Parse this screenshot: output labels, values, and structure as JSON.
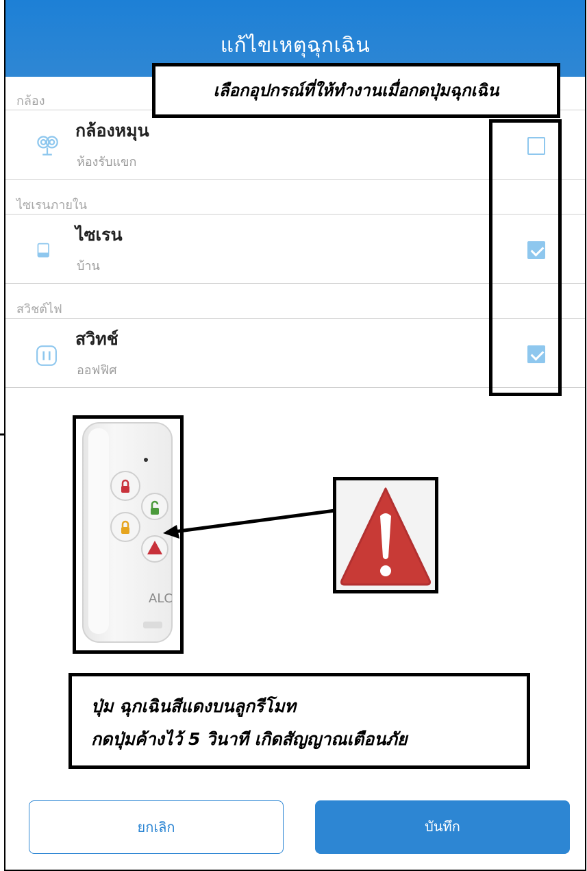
{
  "header": {
    "title": "แก้ไขเหตุฉุกเฉิน"
  },
  "sections": [
    {
      "label": "กล้อง",
      "device": {
        "name": "กล้องหมุน",
        "location": "ห้องรับแขก",
        "icon": "camera-icon",
        "checked": false
      }
    },
    {
      "label": "ไซเรนภายใน",
      "device": {
        "name": "ไซเรน",
        "location": "บ้าน",
        "icon": "siren-icon",
        "checked": true
      }
    },
    {
      "label": "สวิชต์ไฟ",
      "device": {
        "name": "สวิทช์",
        "location": "ออฟฟิศ",
        "icon": "switch-icon",
        "checked": true
      }
    }
  ],
  "annotations": {
    "select_devices": "เลือกอุปกรณ์ที่ให้ทำงานเมื่อกดปุ่มฉุกเฉิน",
    "panic_line1": "ปุ่ม ฉุกเฉินสีแดงบนลูกรีโมท",
    "panic_line2": "กดปุ่มค้างไว้ 5 วินาที เกิดสัญญาณเตือนภัย"
  },
  "remote": {
    "brand": "ALC"
  },
  "buttons": {
    "cancel": "ยกเลิก",
    "save": "บันทึก"
  },
  "colors": {
    "header": "#2f87d4",
    "accent": "#2d86d3",
    "checkbox": "#8ec7ee",
    "warning_red": "#c83a36"
  }
}
